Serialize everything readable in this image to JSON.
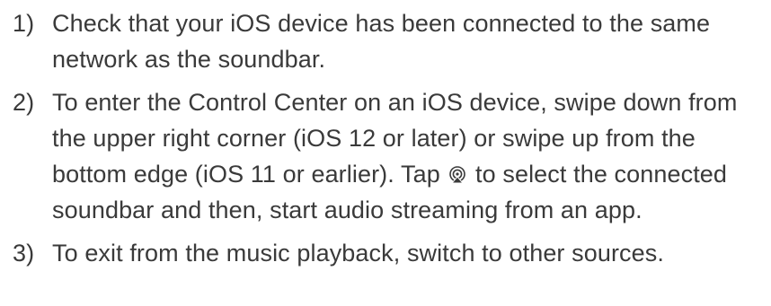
{
  "steps": [
    {
      "number": "1)",
      "text": "Check that your iOS device has been connected to the same network as the soundbar."
    },
    {
      "number": "2)",
      "text_before_icon": "To enter the Control Center on an iOS device, swipe down from the upper right corner (iOS 12 or later) or swipe up from the bottom edge (iOS 11 or earlier). Tap",
      "icon": "airplay-icon",
      "text_after_icon": "to select the connected soundbar and then, start audio streaming from an app."
    },
    {
      "number": "3)",
      "text": "To exit from the music playback, switch to other sources."
    }
  ]
}
